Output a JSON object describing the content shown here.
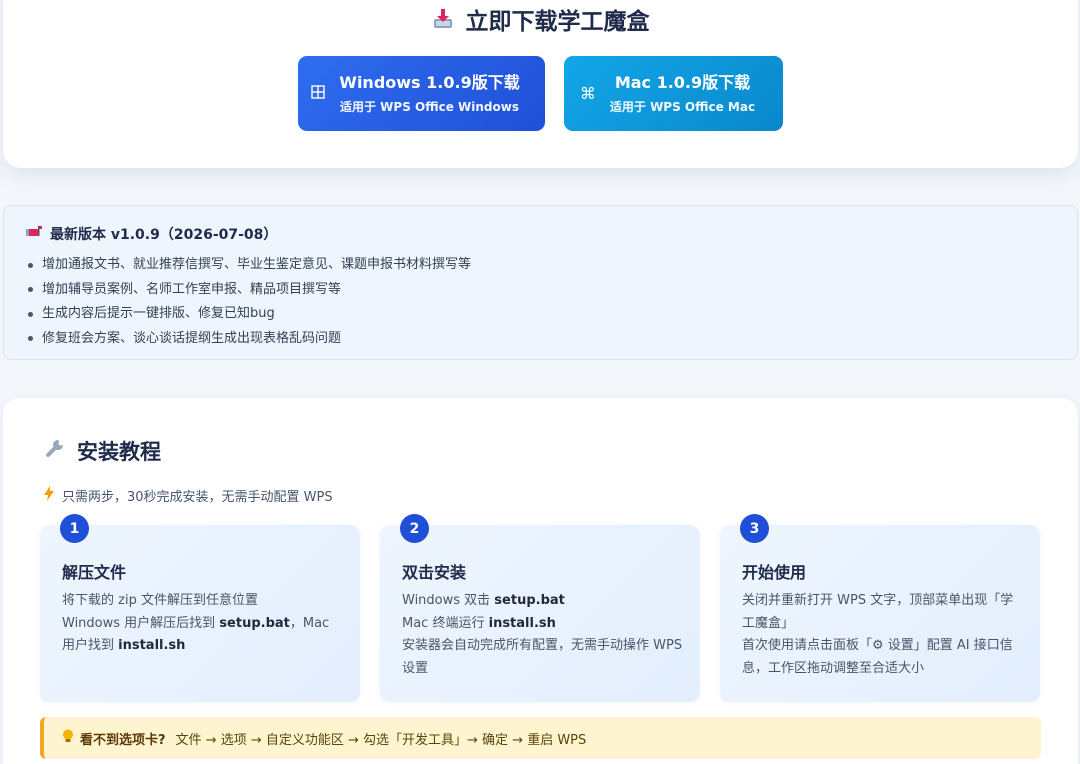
{
  "download": {
    "title": "立即下载学工魔盒",
    "windows": {
      "icon": "windows-icon",
      "label": "Windows 1.0.9版下载",
      "sub": "适用于 WPS Office Windows"
    },
    "mac": {
      "icon": "command-icon",
      "label": "Mac 1.0.9版下载",
      "sub": "适用于 WPS Office Mac"
    }
  },
  "changelog": {
    "heading": "最新版本 v1.0.9（2026-07-08）",
    "items": [
      "增加通报文书、就业推荐信撰写、毕业生鉴定意见、课题申报书材料撰写等",
      "增加辅导员案例、名师工作室申报、精品项目撰写等",
      "生成内容后提示一键排版、修复已知bug",
      "修复班会方案、谈心谈话提纲生成出现表格乱码问题"
    ]
  },
  "tutorial": {
    "title": "安装教程",
    "subtitle": "只需两步，30秒完成安装，无需手动配置 WPS",
    "steps": [
      {
        "num": "1",
        "title": "解压文件",
        "lines": [
          [
            {
              "t": "将下载的 zip 文件解压到任意位置"
            }
          ],
          [
            {
              "t": "Windows 用户解压后找到 "
            },
            {
              "t": "setup.bat",
              "b": true
            },
            {
              "t": "，Mac 用户找到 "
            },
            {
              "t": "install.sh",
              "b": true
            }
          ]
        ]
      },
      {
        "num": "2",
        "title": "双击安装",
        "lines": [
          [
            {
              "t": "Windows 双击 "
            },
            {
              "t": "setup.bat",
              "b": true
            }
          ],
          [
            {
              "t": "Mac 终端运行 "
            },
            {
              "t": "install.sh",
              "b": true
            }
          ],
          [
            {
              "t": "安装器会自动完成所有配置，无需手动操作 WPS 设置"
            }
          ]
        ]
      },
      {
        "num": "3",
        "title": "开始使用",
        "lines": [
          [
            {
              "t": "关闭并重新打开 WPS 文字，顶部菜单出现「学工魔盒」"
            }
          ],
          [
            {
              "t": "首次使用请点击面板「⚙ 设置」配置 AI 接口信息，工作区拖动调整至合适大小"
            }
          ]
        ]
      }
    ],
    "tip": {
      "strong": "看不到选项卡?",
      "text": "文件 → 选项 → 自定义功能区 → 勾选「开发工具」→ 确定 → 重启 WPS"
    }
  },
  "colors": {
    "windows_button": "#2563eb",
    "mac_button": "#0ea5e9",
    "step_badge": "#1e4fd6",
    "tip_border": "#f5a524",
    "tip_background": "#fef4cf"
  }
}
